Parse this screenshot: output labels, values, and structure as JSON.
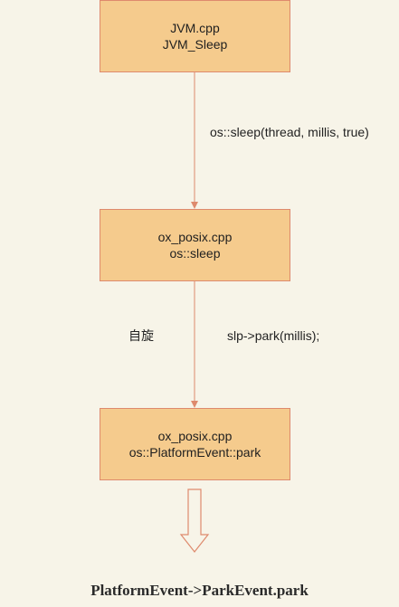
{
  "nodes": [
    {
      "line1": "JVM.cpp",
      "line2": "JVM_Sleep"
    },
    {
      "line1": "ox_posix.cpp",
      "line2": "os::sleep"
    },
    {
      "line1": "ox_posix.cpp",
      "line2": "os::PlatformEvent::park"
    }
  ],
  "edges": [
    {
      "label": "os::sleep(thread, millis, true)"
    },
    {
      "label": "slp->park(millis);",
      "side_label": "自旋"
    }
  ],
  "footer": {
    "text": "PlatformEvent->ParkEvent.park"
  },
  "colors": {
    "background": "#f7f4e8",
    "box_fill": "#f5cb8d",
    "box_border": "#de8a6d",
    "arrow": "#de8a6d"
  }
}
